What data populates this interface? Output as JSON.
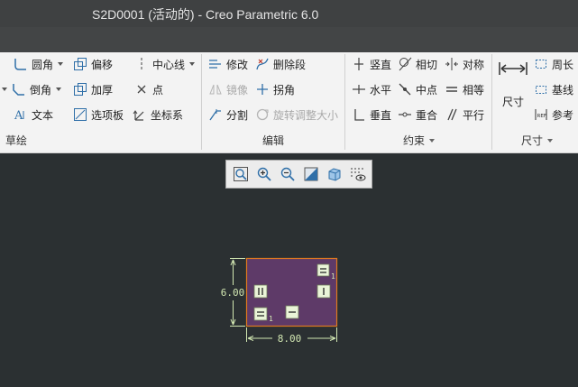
{
  "window": {
    "title": "S2D0001 (活动的) - Creo Parametric 6.0"
  },
  "ribbon": {
    "groups": {
      "sketch": "草绘",
      "edit": "编辑",
      "constrain": "约束",
      "dimension": "尺寸"
    },
    "sketch_tools": {
      "fillet": "圆角",
      "chamfer": "倒角",
      "text": "文本",
      "offset": "偏移",
      "thicken": "加厚",
      "palette": "选项板",
      "centerline": "中心线",
      "point": "点",
      "coordinate_system": "坐标系"
    },
    "edit_tools": {
      "modify": "修改",
      "delete_segment": "删除段",
      "mirror": "镜像",
      "corner": "拐角",
      "divide": "分割",
      "rotate_resize": "旋转调整大小"
    },
    "constrain_tools": {
      "vertical": "竖直",
      "tangent": "相切",
      "symmetric": "对称",
      "horizontal": "水平",
      "midpoint": "中点",
      "equal": "相等",
      "perpendicular": "垂直",
      "coincident": "重合",
      "parallel": "平行"
    },
    "dimension_tools": {
      "dimension": "尺寸",
      "perimeter": "周长",
      "baseline": "基线",
      "reference": "参考"
    }
  },
  "sketch": {
    "width_dimension": "8.00",
    "height_dimension": "6.00",
    "constraint_subscript": "1",
    "rect_fill": "#5e3a68",
    "rect_stroke": "#e07a1e",
    "dim_color": "#d2e7b2"
  }
}
